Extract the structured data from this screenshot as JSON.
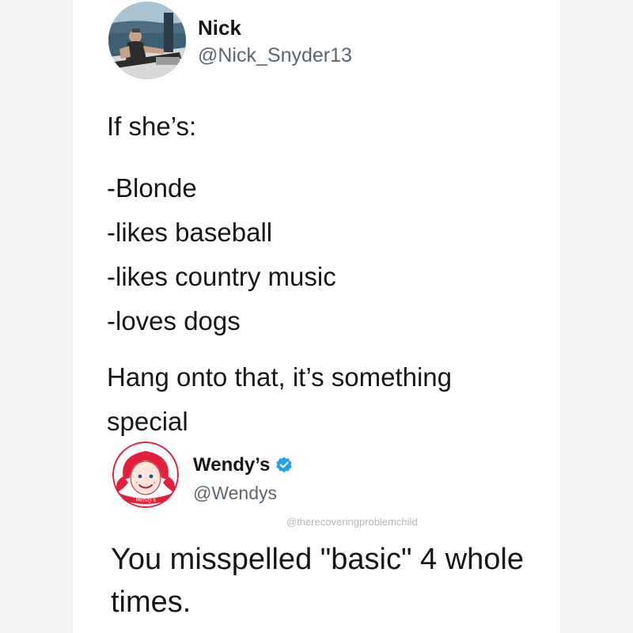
{
  "tweet": {
    "author_name": "Nick",
    "author_handle": "@Nick_Snyder13",
    "lines": [
      "If she’s:",
      "-Blonde",
      "-likes baseball",
      "-likes country music",
      "-loves dogs",
      "Hang onto that, it’s something",
      "special"
    ]
  },
  "reply": {
    "author_name": "Wendy’s",
    "author_handle": "@Wendys",
    "verified_icon": "verified-badge",
    "text_lines": [
      "You misspelled \"basic\" 4 whole",
      "times."
    ]
  },
  "watermark": "@therecoveringproblemchild",
  "logo_text": "Wendy's",
  "colors": {
    "verified": "#1da1f2",
    "text": "#14171a",
    "handle": "#5b6670",
    "wendys_red": "#e2203c"
  }
}
